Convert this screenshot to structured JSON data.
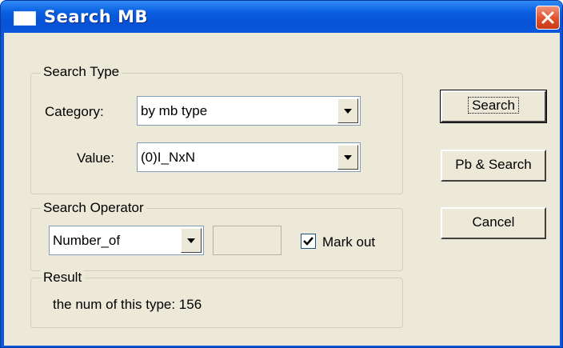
{
  "window": {
    "title": "Search MB",
    "icon": "window-icon",
    "close_icon": "close-icon"
  },
  "search_type": {
    "group_label": "Search Type",
    "category_label": "Category:",
    "category_value": "by mb type",
    "value_label": "Value:",
    "value_value": "(0)I_NxN"
  },
  "search_operator": {
    "group_label": "Search Operator",
    "operator_value": "Number_of",
    "number_value": "",
    "mark_out_label": "Mark out",
    "mark_out_checked": true
  },
  "result": {
    "group_label": "Result",
    "text": "the num of this type: 156"
  },
  "buttons": {
    "search": "Search",
    "pb_search": "Pb & Search",
    "cancel": "Cancel"
  }
}
